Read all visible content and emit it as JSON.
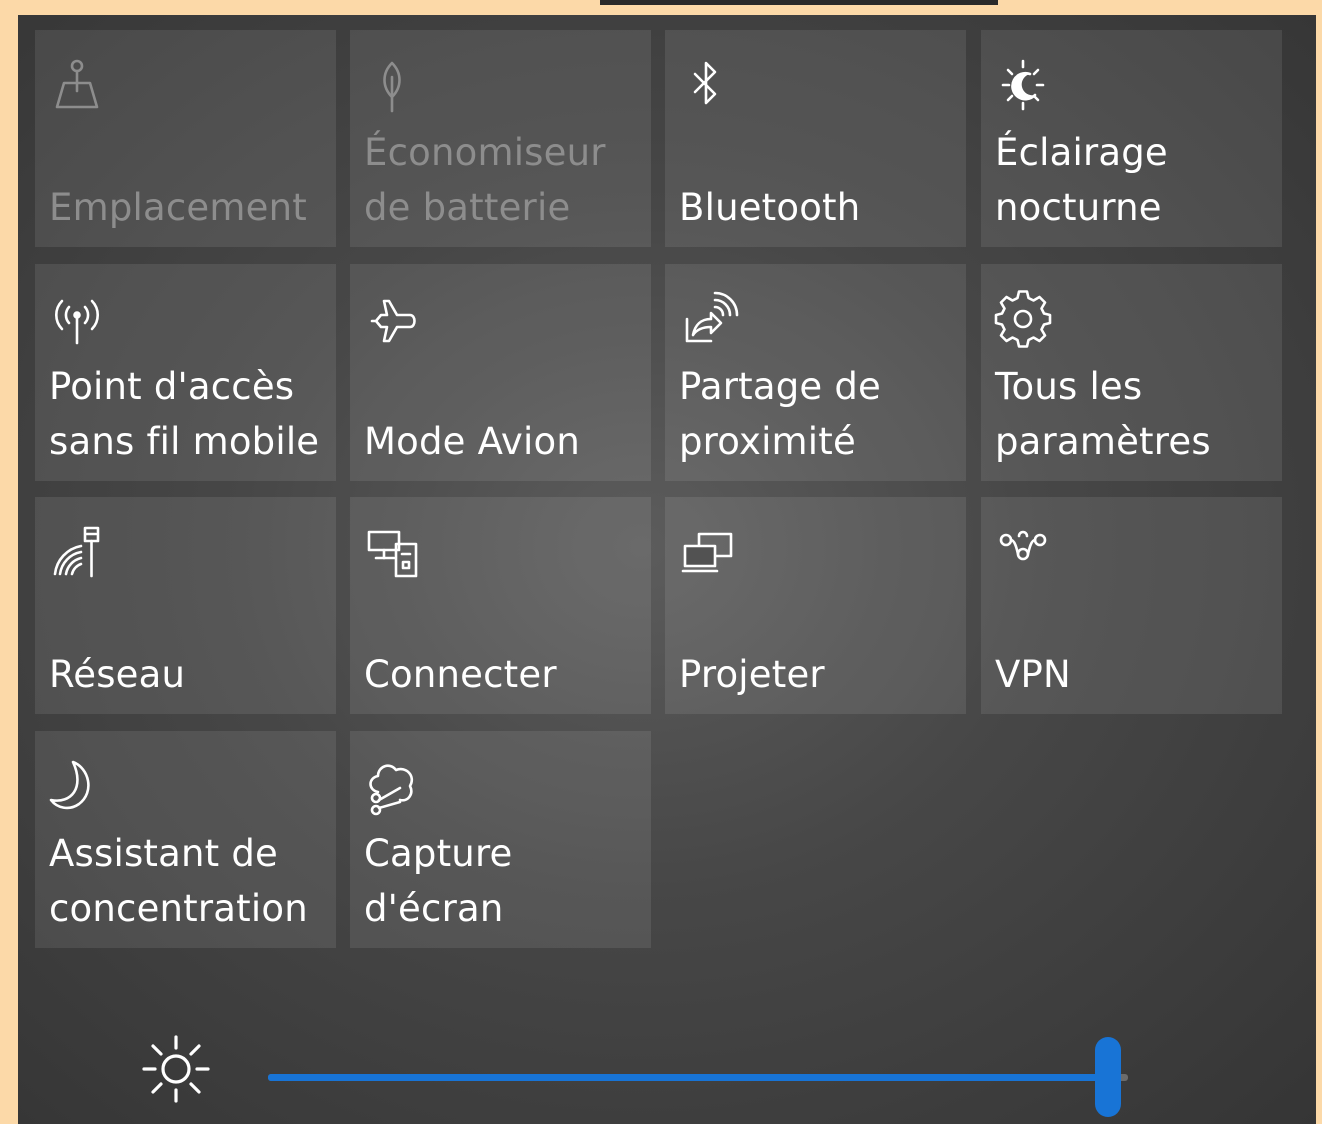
{
  "accent_color": "#1874d6",
  "tiles": [
    {
      "label": "Emplacement",
      "icon": "location-icon",
      "enabled": false
    },
    {
      "label": "Économiseur\nde batterie",
      "icon": "battery-saver-icon",
      "enabled": false
    },
    {
      "label": "Bluetooth",
      "icon": "bluetooth-icon",
      "enabled": true
    },
    {
      "label": "Éclairage\nnocturne",
      "icon": "night-light-icon",
      "enabled": true
    },
    {
      "label": "Point d'accès\nsans fil mobile",
      "icon": "mobile-hotspot-icon",
      "enabled": true
    },
    {
      "label": "Mode Avion",
      "icon": "airplane-icon",
      "enabled": true
    },
    {
      "label": "Partage de\nproximité",
      "icon": "nearby-sharing-icon",
      "enabled": true
    },
    {
      "label": "Tous les\nparamètres",
      "icon": "gear-icon",
      "enabled": true
    },
    {
      "label": "Réseau",
      "icon": "network-icon",
      "enabled": true
    },
    {
      "label": "Connecter",
      "icon": "connect-icon",
      "enabled": true
    },
    {
      "label": "Projeter",
      "icon": "project-icon",
      "enabled": true
    },
    {
      "label": "VPN",
      "icon": "vpn-icon",
      "enabled": true
    },
    {
      "label": "Assistant de\nconcentration",
      "icon": "focus-assist-icon",
      "enabled": true
    },
    {
      "label": "Capture\nd'écran",
      "icon": "screen-snip-icon",
      "enabled": true
    }
  ],
  "brightness": {
    "icon": "brightness-icon",
    "value": 1.0
  }
}
